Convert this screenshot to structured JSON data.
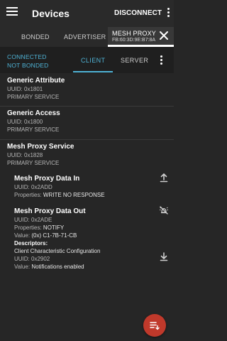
{
  "appbar": {
    "title": "Devices",
    "disconnect_label": "DISCONNECT"
  },
  "device_tabs": {
    "bonded": "BONDED",
    "advertiser": "ADVERTISER",
    "active_label": "MESH PROXY",
    "active_address": "FB:60:3D:9E:B7:8A"
  },
  "connection": {
    "state": "CONNECTED",
    "bond_state": "NOT BONDED",
    "tab_client": "CLIENT",
    "tab_server": "SERVER"
  },
  "services": [
    {
      "name": "Generic Attribute",
      "uuid": "UUID: 0x1801",
      "type": "PRIMARY SERVICE"
    },
    {
      "name": "Generic Access",
      "uuid": "UUID: 0x1800",
      "type": "PRIMARY SERVICE"
    },
    {
      "name": "Mesh Proxy Service",
      "uuid": "UUID: 0x1828",
      "type": "PRIMARY SERVICE"
    }
  ],
  "characteristics": [
    {
      "name": "Mesh Proxy Data In",
      "uuid": "UUID: 0x2ADD",
      "properties_label": "Properties:",
      "properties_value": "WRITE NO RESPONSE",
      "action_icon": "upload-icon"
    },
    {
      "name": "Mesh Proxy Data Out",
      "uuid": "UUID: 0x2ADE",
      "properties_label": "Properties:",
      "properties_value": "NOTIFY",
      "value_label": "Value:",
      "value_value": "(0x) C1-7B-71-CB",
      "action_icon": "notifications-disable-icon",
      "descriptors_heading": "Descriptors:",
      "descriptor": {
        "name": "Client Characteristic Configuration",
        "uuid": "UUID: 0x2902",
        "value_label": "Value:",
        "value_value": "Notifications enabled",
        "action_icon": "download-icon"
      }
    }
  ],
  "fab": {
    "icon": "log-icon"
  },
  "colors": {
    "accent": "#4fb3d6",
    "fab": "#c0392b",
    "background": "#262626"
  }
}
